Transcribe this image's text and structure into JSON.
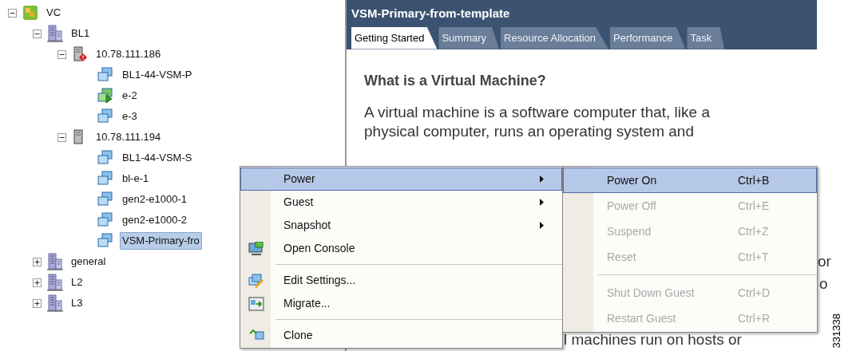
{
  "tree": [
    {
      "label": "VC",
      "kind": "root",
      "expanded": true,
      "selected": false,
      "children": [
        {
          "label": "BL1",
          "kind": "datacenter",
          "expanded": true,
          "selected": false,
          "children": [
            {
              "label": "10.78.111.186",
              "kind": "host",
              "alert": true,
              "expanded": true,
              "selected": false,
              "children": [
                {
                  "label": "BL1-44-VSM-P",
                  "kind": "vm",
                  "powered_on": false,
                  "selected": false
                },
                {
                  "label": "e-2",
                  "kind": "vm",
                  "powered_on": true,
                  "selected": false
                },
                {
                  "label": "e-3",
                  "kind": "vm",
                  "powered_on": false,
                  "selected": false
                }
              ]
            },
            {
              "label": "10.78.111.194",
              "kind": "host",
              "alert": false,
              "expanded": true,
              "selected": false,
              "children": [
                {
                  "label": "BL1-44-VSM-S",
                  "kind": "vm",
                  "powered_on": false,
                  "selected": false
                },
                {
                  "label": "bl-e-1",
                  "kind": "vm",
                  "powered_on": false,
                  "selected": false
                },
                {
                  "label": "gen2-e1000-1",
                  "kind": "vm",
                  "powered_on": false,
                  "selected": false
                },
                {
                  "label": "gen2-e1000-2",
                  "kind": "vm",
                  "powered_on": false,
                  "selected": false
                },
                {
                  "label": "VSM-Primary-fro",
                  "kind": "vm",
                  "powered_on": false,
                  "selected": true
                }
              ]
            }
          ]
        },
        {
          "label": "general",
          "kind": "datacenter",
          "expanded": false,
          "selected": false
        },
        {
          "label": "L2",
          "kind": "datacenter",
          "expanded": false,
          "selected": false
        },
        {
          "label": "L3",
          "kind": "datacenter",
          "expanded": false,
          "selected": false
        }
      ]
    }
  ],
  "panel": {
    "title": "VSM-Primary-from-template",
    "tabs": [
      {
        "label": "Getting Started",
        "selected": true
      },
      {
        "label": "Summary",
        "selected": false
      },
      {
        "label": "Resource Allocation",
        "selected": false
      },
      {
        "label": "Performance",
        "selected": false
      },
      {
        "label": "Task",
        "selected": false
      }
    ],
    "heading": "What is a Virtual Machine?",
    "paragraph_lines": [
      "A virtual machine is a software computer that, like a",
      "physical computer, runs an operating system and"
    ],
    "fragments": [
      "or",
      "o"
    ],
    "bottom_line": "l machines run on hosts or"
  },
  "context_menu": [
    {
      "kind": "item",
      "label": "Power",
      "submenu": true,
      "selected": true
    },
    {
      "kind": "item",
      "label": "Guest",
      "submenu": true,
      "selected": false
    },
    {
      "kind": "item",
      "label": "Snapshot",
      "submenu": true,
      "selected": false
    },
    {
      "kind": "item",
      "label": "Open Console",
      "submenu": false,
      "selected": false
    },
    {
      "kind": "separator"
    },
    {
      "kind": "item",
      "label": "Edit Settings...",
      "submenu": false,
      "selected": false
    },
    {
      "kind": "item",
      "label": "Migrate...",
      "submenu": false,
      "selected": false
    },
    {
      "kind": "separator"
    },
    {
      "kind": "item",
      "label": "Clone",
      "submenu": false,
      "selected": false
    }
  ],
  "submenu": [
    {
      "kind": "item",
      "label": "Power On",
      "shortcut": "Ctrl+B",
      "selected": true,
      "disabled": false
    },
    {
      "kind": "item",
      "label": "Power Off",
      "shortcut": "Ctrl+E",
      "selected": false,
      "disabled": true
    },
    {
      "kind": "item",
      "label": "Suspend",
      "shortcut": "Ctrl+Z",
      "selected": false,
      "disabled": true
    },
    {
      "kind": "item",
      "label": "Reset",
      "shortcut": "Ctrl+T",
      "selected": false,
      "disabled": true
    },
    {
      "kind": "separator"
    },
    {
      "kind": "item",
      "label": "Shut Down Guest",
      "shortcut": "Ctrl+D",
      "selected": false,
      "disabled": true
    },
    {
      "kind": "item",
      "label": "Restart Guest",
      "shortcut": "Ctrl+R",
      "selected": false,
      "disabled": true
    }
  ],
  "figure_id": "331338"
}
